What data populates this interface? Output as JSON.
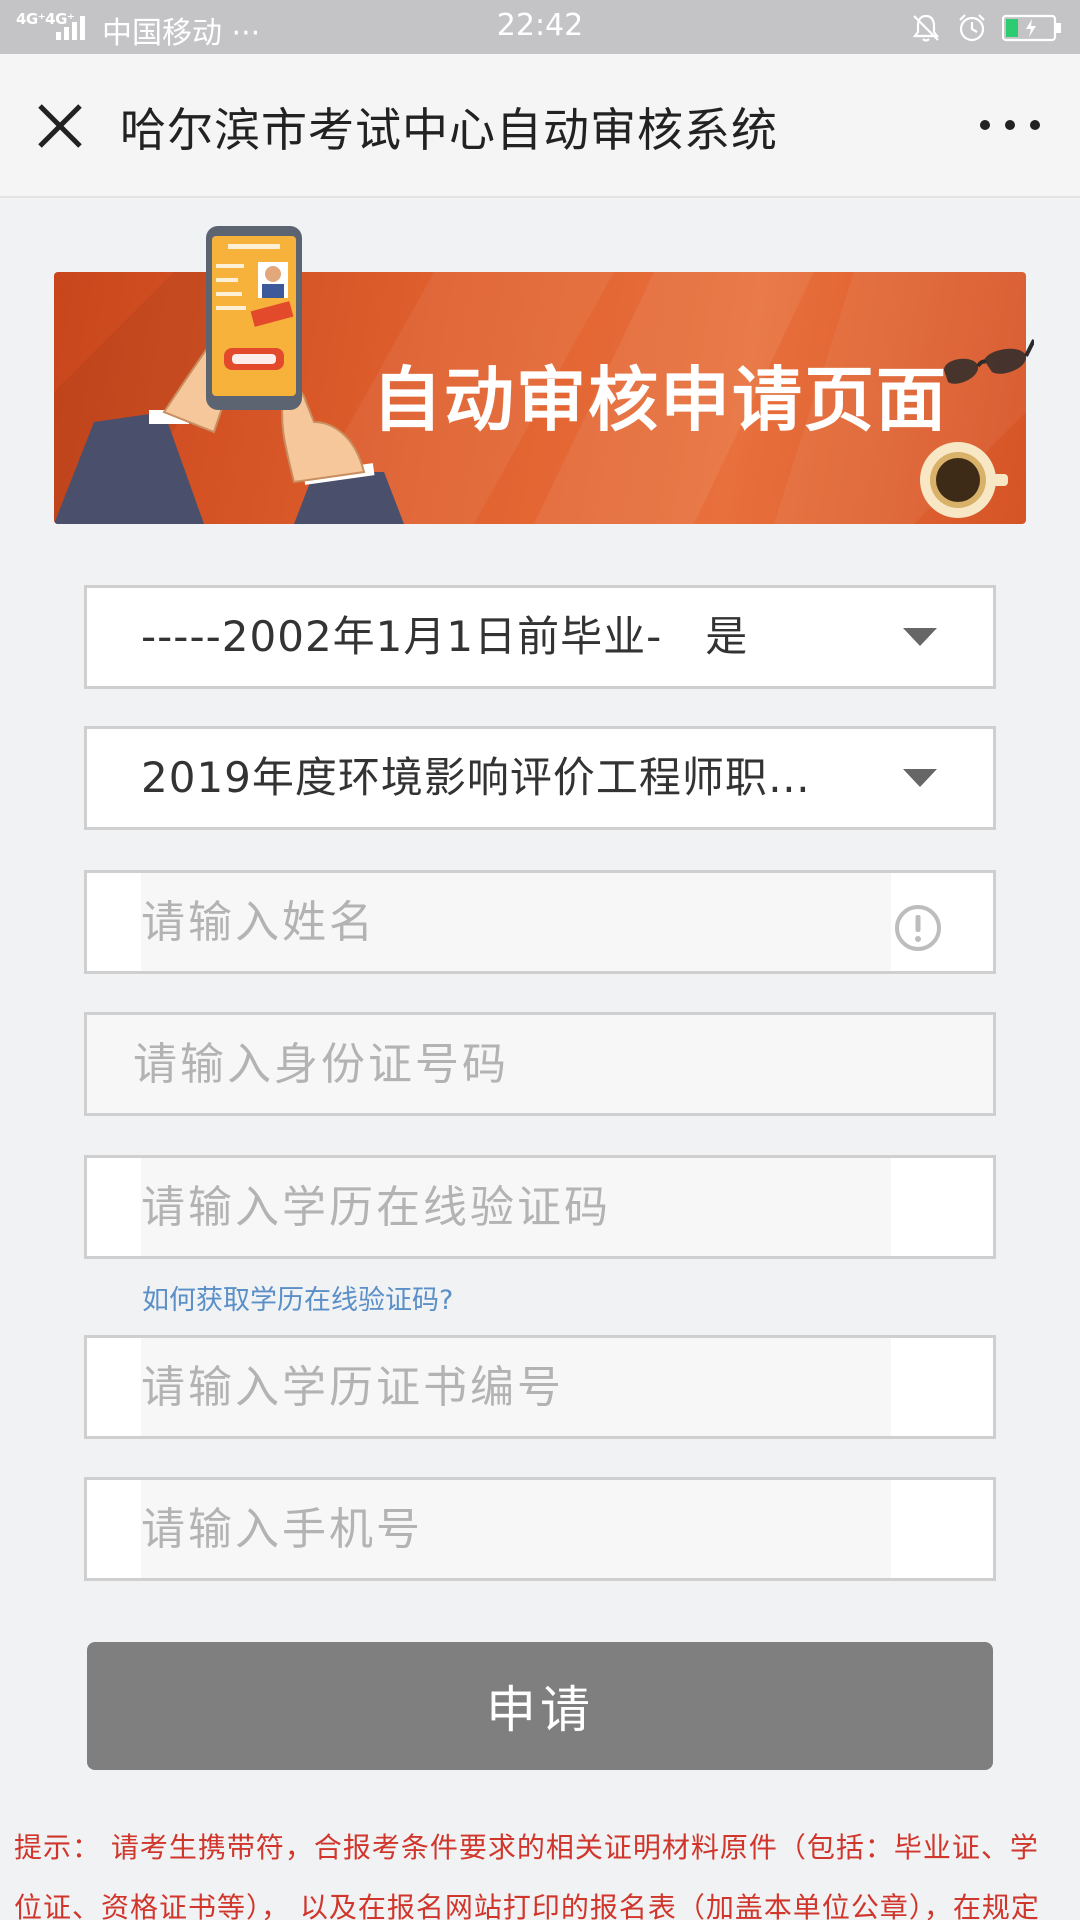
{
  "status_bar": {
    "network": "4G⁺4G⁺",
    "carrier": "中国移动 ···",
    "time": "22:42"
  },
  "title_bar": {
    "title": "哈尔滨市考试中心自动审核系统"
  },
  "banner": {
    "title": "自动审核申请页面"
  },
  "form": {
    "graduation_select": "-----2002年1月1日前毕业-　是",
    "exam_select": "2019年度环境影响评价工程师职…",
    "name_placeholder": "请输入姓名",
    "id_placeholder": "请输入身份证号码",
    "verify_code_placeholder": "请输入学历在线验证码",
    "help_link": "如何获取学历在线验证码?",
    "cert_no_placeholder": "请输入学历证书编号",
    "phone_placeholder": "请输入手机号",
    "submit_label": "申请"
  },
  "tip": {
    "text": "提示： 请考生携带符，合报考条件要求的相关证明材料原件（包括：毕业证、学位证、资格证书等）， 以及在报名网站打印的报名表（加盖本单位公章），在规定的日"
  },
  "colors": {
    "banner": "#e0602e",
    "button": "#7f7f7f",
    "link": "#5a8fc8",
    "tip": "#d0362b"
  }
}
